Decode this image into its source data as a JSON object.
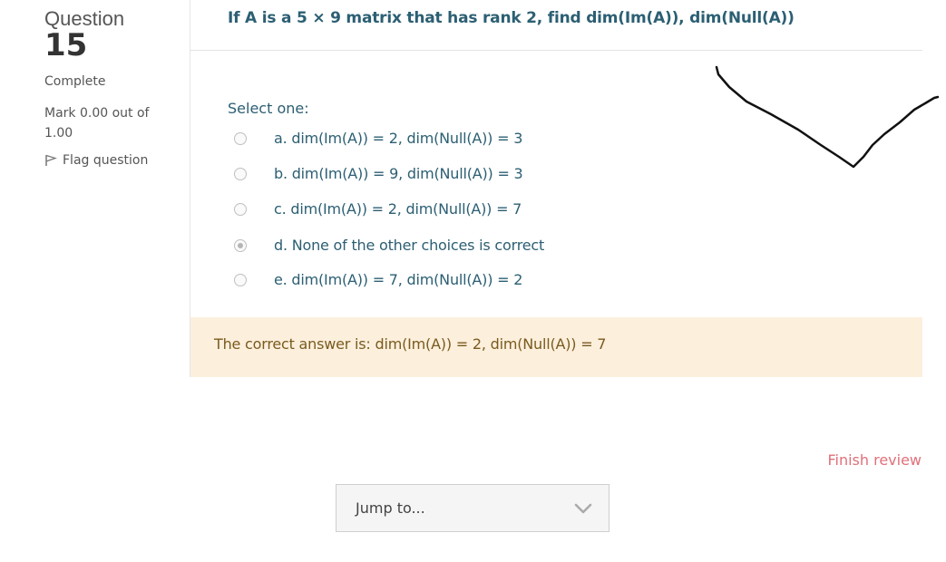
{
  "question_info": {
    "label": "Question",
    "number": "15",
    "state": "Complete",
    "grade": "Mark 0.00 out of 1.00",
    "flag_label": "Flag question"
  },
  "question": {
    "text": "If A is a 5 × 9 matrix that has rank 2, find dim(Im(A)), dim(Null(A))",
    "prompt": "Select one:"
  },
  "answers": [
    {
      "label": "a. dim(Im(A)) = 2, dim(Null(A)) = 3",
      "checked": false
    },
    {
      "label": "b. dim(Im(A)) = 9, dim(Null(A)) = 3",
      "checked": false
    },
    {
      "label": "c. dim(Im(A)) = 2, dim(Null(A)) = 7",
      "checked": false
    },
    {
      "label": "d. None of the other choices is correct",
      "checked": true
    },
    {
      "label": "e. dim(Im(A)) = 7, dim(Null(A)) = 2",
      "checked": false
    }
  ],
  "feedback": {
    "right_answer": "The correct answer is: dim(Im(A)) = 2, dim(Null(A)) = 7"
  },
  "navigation": {
    "finish_review": "Finish review",
    "jump_to": "Jump to..."
  },
  "colors": {
    "accent_text": "#2c5f73",
    "feedback_bg": "#fcefdc",
    "link_red": "#e0707a"
  },
  "icons": [
    "flag-icon",
    "chevron-down-icon",
    "handwritten-checkmark"
  ]
}
